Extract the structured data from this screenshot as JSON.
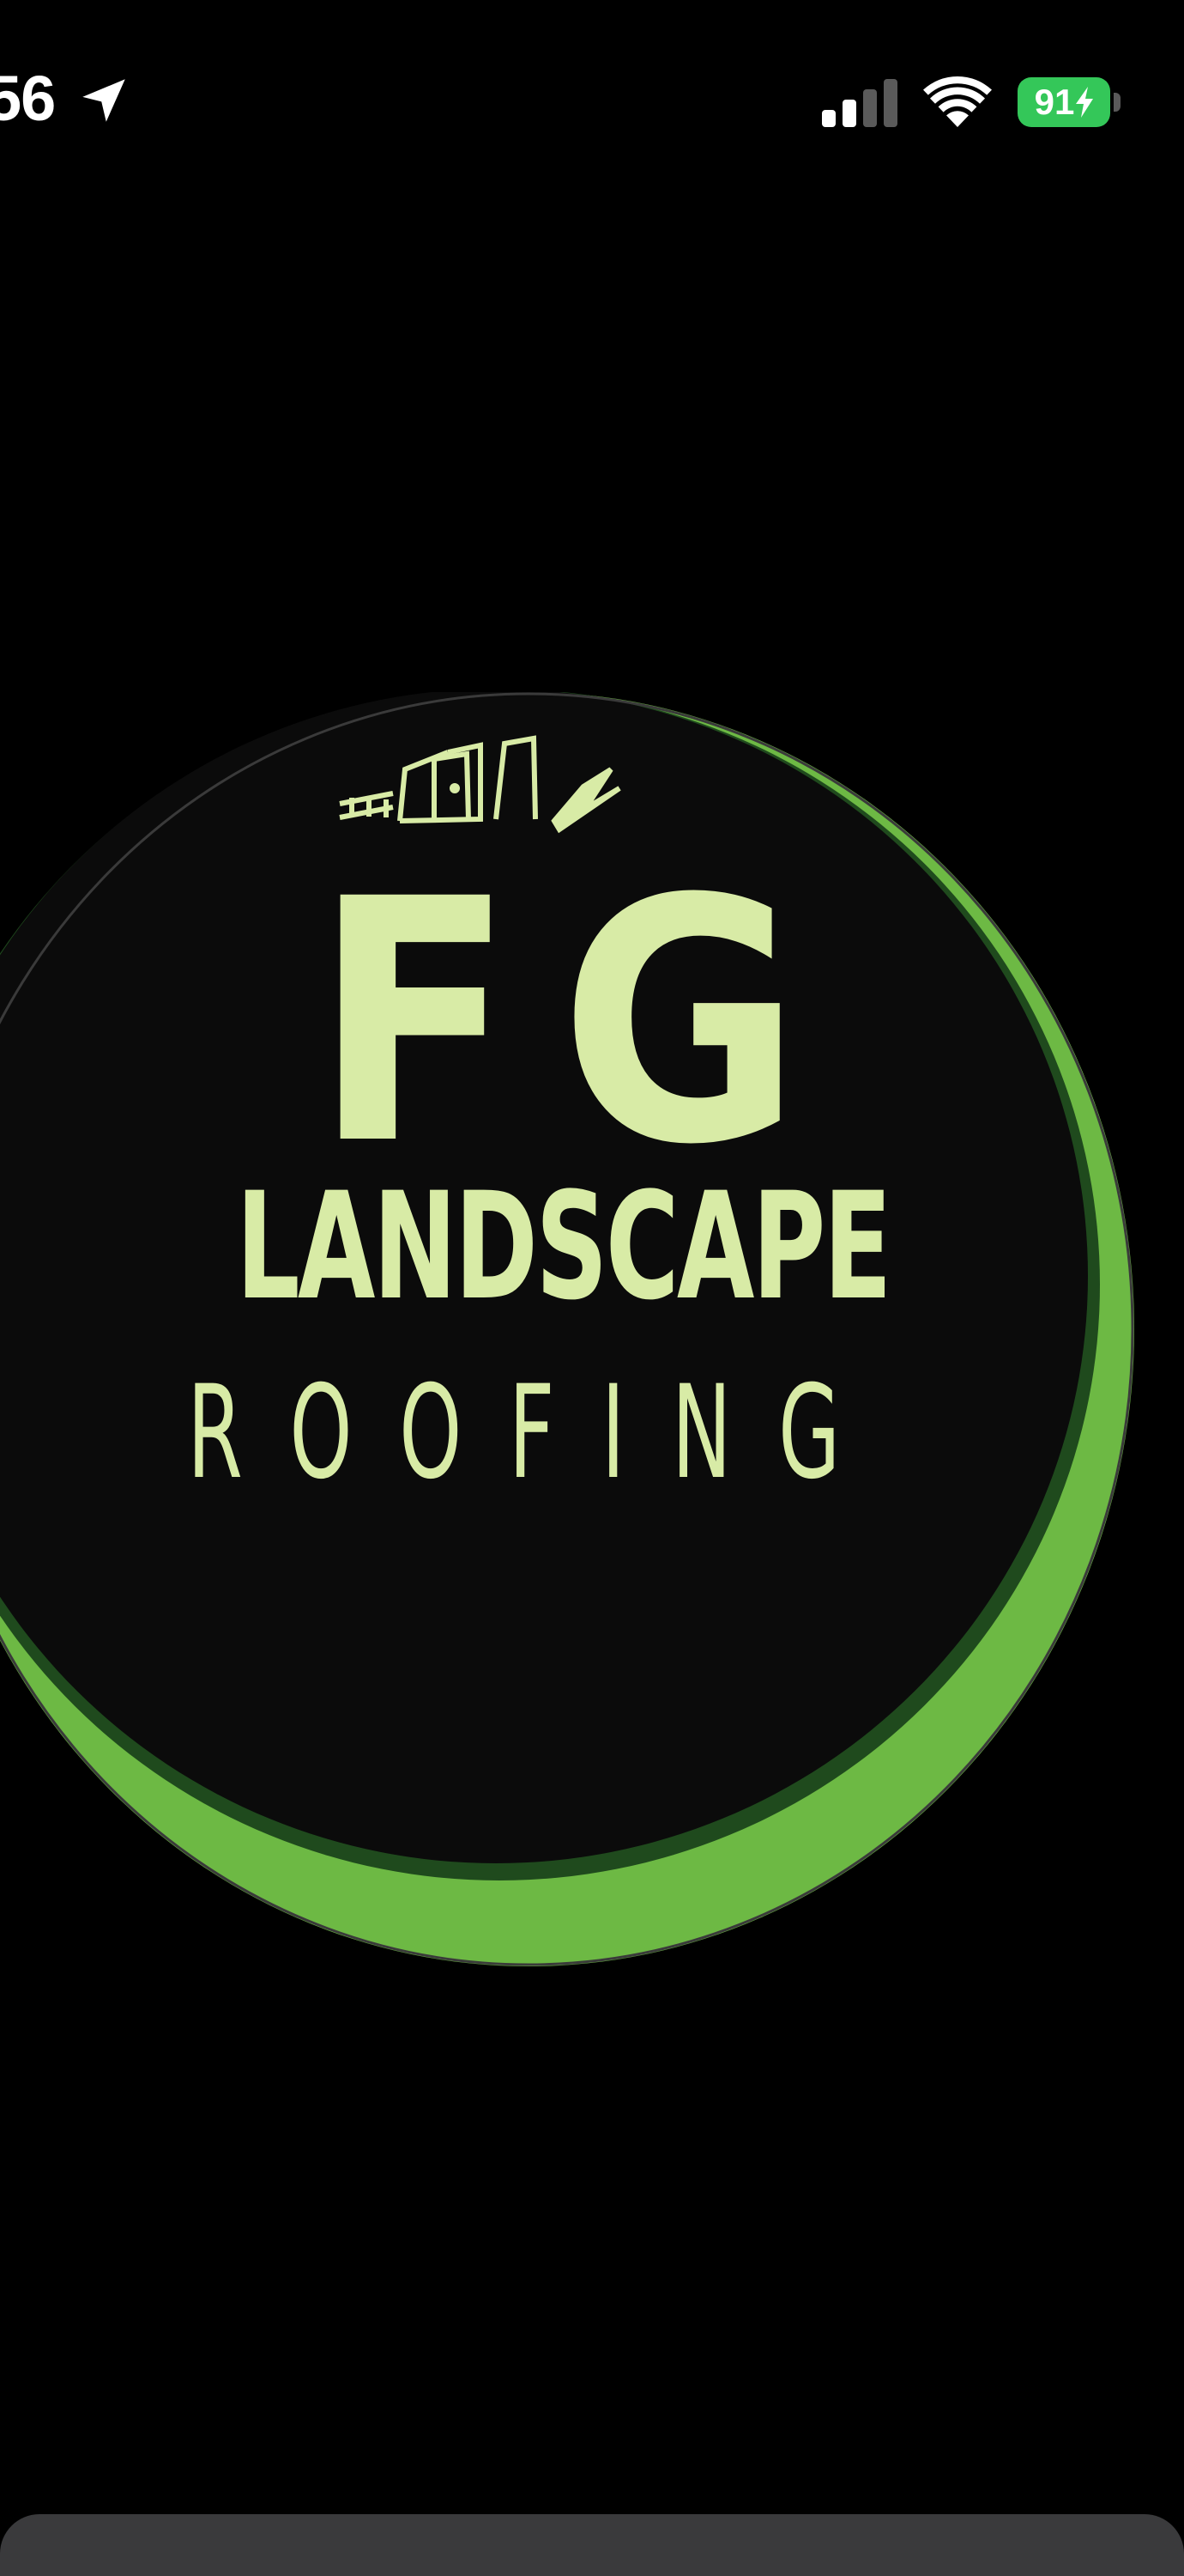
{
  "status_bar": {
    "time": "56",
    "location_icon": "location-arrow-icon",
    "signal_icon": "cellular-signal-icon",
    "wifi_icon": "wifi-icon",
    "battery_level": "91",
    "battery_icon": "charging-bolt-icon",
    "battery_color": "#34c759"
  },
  "logo": {
    "line1": "FG",
    "line2": "LANDSCAPE",
    "line3": "ROOFING",
    "text_color": "#d8eba6",
    "accent_color": "#6db944",
    "background_color": "#0b0b0b"
  },
  "bottom_sheet": {
    "color": "#3a3a3c"
  }
}
